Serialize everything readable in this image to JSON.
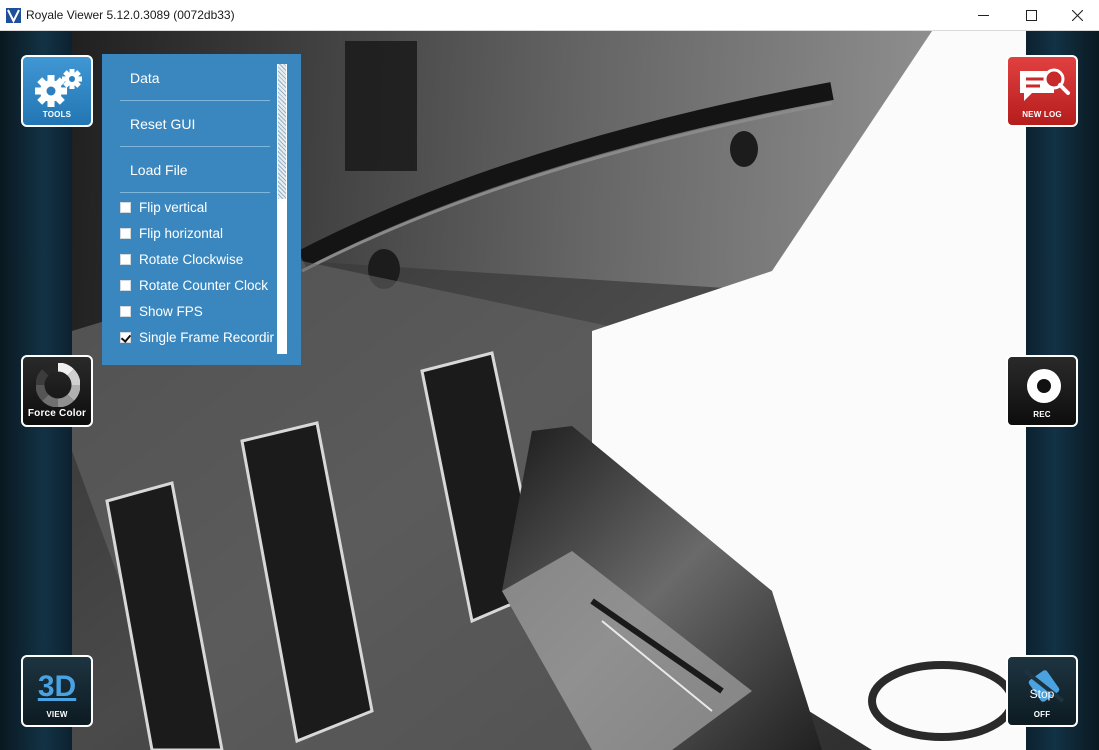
{
  "window": {
    "title": "Royale Viewer 5.12.0.3089 (0072db33)"
  },
  "buttons": {
    "tools": {
      "label": "TOOLS",
      "icon": "gears-icon"
    },
    "force_color": {
      "label": "Force Color",
      "icon": "color-ring-icon"
    },
    "view_3d": {
      "label": "VIEW",
      "glyph": "3D"
    },
    "new_log": {
      "label": "NEW LOG",
      "icon": "log-search-icon"
    },
    "rec": {
      "label": "REC",
      "icon": "record-icon"
    },
    "stop": {
      "label": "OFF",
      "glyph": "Stop"
    }
  },
  "tools_menu": {
    "items": [
      {
        "label": "Data"
      },
      {
        "label": "Reset GUI"
      },
      {
        "label": "Load File"
      }
    ],
    "checkboxes": [
      {
        "label": "Flip vertical",
        "checked": false
      },
      {
        "label": "Flip horizontal",
        "checked": false
      },
      {
        "label": "Rotate Clockwise",
        "checked": false
      },
      {
        "label": "Rotate Counter Clock",
        "checked": false
      },
      {
        "label": "Show FPS",
        "checked": false
      },
      {
        "label": "Single Frame Recordir",
        "checked": true
      }
    ]
  },
  "colors": {
    "tools_blue": "#2a80c0",
    "menu_blue": "#3a87bf",
    "new_log_red": "#c62a2a",
    "dark_button": "#161616",
    "background": "#0c2230"
  }
}
